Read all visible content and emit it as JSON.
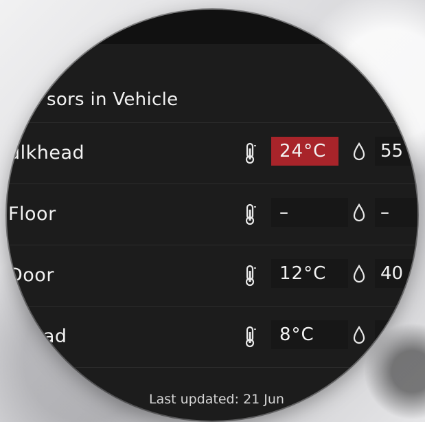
{
  "panel": {
    "title": "sors in Vehicle",
    "last_updated": "Last updated: 21 Jun"
  },
  "sensors": [
    {
      "location": "ulkhead",
      "temperature": "24°C",
      "humidity": "55",
      "alert": true
    },
    {
      "location": "Floor",
      "temperature": "–",
      "humidity": "–",
      "alert": false
    },
    {
      "location": "Door",
      "temperature": "12°C",
      "humidity": "40",
      "alert": false
    },
    {
      "location": "khead",
      "temperature": "8°C",
      "humidity": "",
      "alert": false
    }
  ],
  "colors": {
    "alert": "#a8242a",
    "panel_bg": "#1c1c1c",
    "text": "#f2f2f2"
  },
  "icons": {
    "temperature": "thermometer-icon",
    "humidity": "water-drop-icon"
  }
}
